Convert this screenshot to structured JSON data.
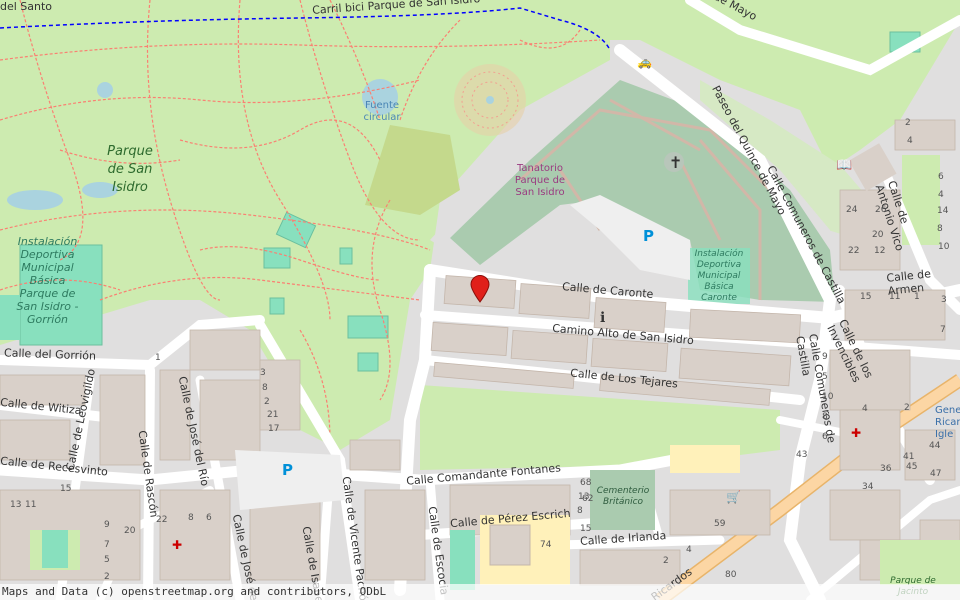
{
  "map": {
    "attribution": "Maps and Data (c) openstreetmap.org and contributors, ODbL",
    "colors": {
      "park": "#cdebb0",
      "grass": "#c8facc",
      "residential": "#e0dfdf",
      "building": "#d9d0c9",
      "road": "#ffffff",
      "primary_road": "#fcd6a4",
      "cemetery": "#aacbaf",
      "sports": "#88e0be",
      "water": "#aad3df",
      "footway": "#fa8072",
      "cycleway": "#0000ff",
      "marker": "#e0201a"
    },
    "streets": {
      "carril_bici": "Carril bici Parque de San Isidro",
      "del_santo": "del Santo",
      "de_mayo": "de Mayo",
      "paseo_quince_mayo": "Paseo del Quince de Mayo",
      "comuneros_castilla_top": "Calle Comuneros de Castilla",
      "antonio_vico": "Calle de Antonio Vico",
      "armen": "Calle de Armen",
      "caronte": "Calle de Caronte",
      "camino_alto": "Camino Alto de San Isidro",
      "tejares": "Calle de Los Tejares",
      "comuneros_castilla_bottom": "Calle Comuneros de Castilla",
      "invencibles": "Calle de los Invencibles",
      "gorrion": "Calle del Gorrión",
      "leovigildo": "Calle de Leovigildo",
      "witiza": "Calle de Witiza",
      "recesvinto": "Calle de Recesvinto",
      "rascon": "Calle de Rascón",
      "jose_rio": "Calle de José del Río",
      "jose_rio_2": "Calle de José del",
      "vicente_pacheco": "Calle de Vicente Pachón",
      "isabel": "Calle de Isabel",
      "comandante_fontanes": "Calle Comandante Fontanes",
      "escocia": "Calle de Escocia",
      "perez_escrich": "Calle de Pérez Escrich",
      "irlanda": "Calle de Irlanda",
      "ricardos": "Ricardos"
    },
    "places": {
      "parque_san_isidro": "Parque de San Isidro",
      "fuente_circular": "Fuente circular",
      "instalacion_gorrion": "Instalación Deportiva Municipal Básica Parque de San Isidro - Gorrión",
      "tanatorio": "Tanatorio Parque de San Isidro",
      "instalacion_caronte": "Instalación Deportiva Municipal Básica Caronte",
      "cementerio_britanico": "Cementerio Británico",
      "parque_jacinto": "Parque de Jacinto",
      "gene_ricar_igle": "Gene Ricar Igle"
    },
    "housenumbers": [
      "2",
      "4",
      "24",
      "26",
      "20",
      "22",
      "12",
      "14",
      "8",
      "10",
      "4",
      "6",
      "15",
      "11",
      "1",
      "3",
      "7",
      "9",
      "5",
      "10",
      "8",
      "6",
      "4",
      "2",
      "36",
      "34",
      "43",
      "47",
      "44",
      "41",
      "45",
      "1",
      "3",
      "8",
      "2",
      "21",
      "17",
      "15",
      "13",
      "11",
      "9",
      "7",
      "5",
      "2",
      "20",
      "22",
      "8",
      "6",
      "4",
      "2",
      "80",
      "74",
      "68",
      "62",
      "59",
      "8",
      "13",
      "15",
      "1",
      "3",
      "21"
    ],
    "parking_label": "P"
  }
}
